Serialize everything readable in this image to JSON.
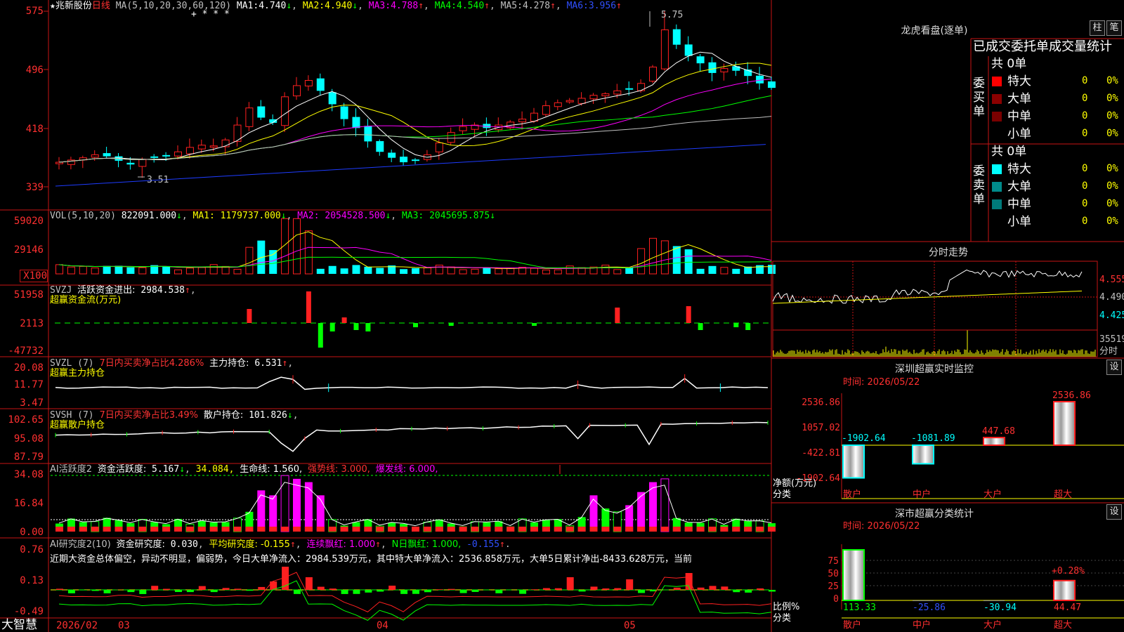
{
  "stock": {
    "name": "兆新股份",
    "period": "日线",
    "star": "★"
  },
  "colors": {
    "up": "#ff2020",
    "down": "#00ffff",
    "ma1": "#ffffff",
    "ma2": "#ffff00",
    "ma3": "#ff00ff",
    "ma4": "#00ff00",
    "ma5": "#c0c0c0",
    "ma6": "#1e3cff",
    "grid": "#c81414",
    "yellow": "#ffff00",
    "green": "#00ff00"
  },
  "main": {
    "ma_label": "MA(5,10,20,30,60,120)",
    "ma": [
      {
        "name": "MA1:",
        "value": "4.740",
        "arrow": "↓"
      },
      {
        "name": "MA2:",
        "value": "4.940",
        "arrow": "↓"
      },
      {
        "name": "MA3:",
        "value": "4.788",
        "arrow": "↑"
      },
      {
        "name": "MA4:",
        "value": "4.540",
        "arrow": "↑"
      },
      {
        "name": "MA5:",
        "value": "4.278",
        "arrow": "↑"
      },
      {
        "name": "MA6:",
        "value": "3.956",
        "arrow": "↑"
      }
    ],
    "y_ticks": [
      "575",
      "496",
      "418",
      "339"
    ],
    "high_label": "5.75",
    "low_label": "3.51",
    "marks": "+  * * *"
  },
  "vol": {
    "label": "VOL(5,10,20)",
    "value": "822091.000",
    "v_arrow": "↓",
    "ma1": "MA1: 1179737.000",
    "ma1_arrow": "↓",
    "ma2": "MA2: 2054528.500",
    "ma2_arrow": "↓",
    "ma3": "MA3: 2045695.875",
    "ma3_arrow": "↓",
    "y_ticks": [
      "59020",
      "29146"
    ],
    "unit": "X100"
  },
  "svzj": {
    "name": "SVZJ",
    "desc": "活跃资金进出:",
    "value": "2984.538",
    "arrow": "↑",
    "sub": "超赢资金流(万元)",
    "y_ticks": [
      "51958",
      "2113",
      "-47732"
    ]
  },
  "svzl": {
    "name": "SVZL (7)",
    "desc": "7日内买卖净占比4.286%",
    "main": "主力持仓:",
    "value": "6.531",
    "arrow": "↑",
    "sub": "超赢主力持仓",
    "y_ticks": [
      "20.08",
      "11.77",
      "3.47"
    ]
  },
  "svsh": {
    "name": "SVSH (7)",
    "desc": "7日内买卖净占比3.49%",
    "main": "散户持仓:",
    "value": "101.826",
    "arrow": "↓",
    "sub": "超赢散户持仓",
    "y_ticks": [
      "102.65",
      "95.08",
      "87.79"
    ]
  },
  "ai1": {
    "name": "AI活跃度2",
    "desc": "资金活跃度:",
    "value": "5.167",
    "arrow": "↓",
    "v2": "34.084,",
    "v3": "生命线: 1.560,",
    "v4": "强势线: 3.000,",
    "v5": "爆发线: 6.000,",
    "y_ticks": [
      "34.08",
      "16.84",
      "0.00"
    ]
  },
  "ai2": {
    "name": "AI研究度2(10)",
    "desc": "资金研究度:",
    "value": "0.030",
    "avg": "平均研究度: -0.155",
    "avg_arrow": "↑",
    "c1": "连续飘红: 1.000",
    "c1_arrow": "↑",
    "c2": "N日飘红: 1.000,",
    "c3": "-0.155",
    "c3_arrow": "↑",
    "text": "近期大资金总体偏空，异动不明显，偏弱势，今日大单净流入：2984.539万元，其中特大单净流入：2536.858万元，大单5日累计净出-8433.628万元，当前",
    "y_ticks": [
      "0.76",
      "0.13",
      "-0.49"
    ]
  },
  "xaxis": {
    "brand": "大智慧",
    "labels": [
      "2026/02",
      "03",
      "04",
      "05"
    ]
  },
  "lhb": {
    "title": "龙虎看盘(逐单)",
    "btn1": "柱",
    "btn2": "笔",
    "header": "已成交委托单成交量统计",
    "buy": {
      "label": "委买单",
      "total": "共 0单",
      "rows": [
        {
          "name": "特大",
          "n": "0",
          "p": "0%"
        },
        {
          "name": "大单",
          "n": "0",
          "p": "0%"
        },
        {
          "name": "中单",
          "n": "0",
          "p": "0%"
        },
        {
          "name": "小单",
          "n": "0",
          "p": "0%"
        }
      ]
    },
    "sell": {
      "label": "委卖单",
      "total": "共 0单",
      "rows": [
        {
          "name": "特大",
          "n": "0",
          "p": "0%"
        },
        {
          "name": "大单",
          "n": "0",
          "p": "0%"
        },
        {
          "name": "中单",
          "n": "0",
          "p": "0%"
        },
        {
          "name": "小单",
          "n": "0",
          "p": "0%"
        }
      ]
    }
  },
  "intraday": {
    "title": "分时走势",
    "p1": "4.555",
    "p2": "4.490",
    "p3": "4.425",
    "vol": "35519",
    "vol_label": "分时"
  },
  "monitor": {
    "title": "深圳超赢实时监控",
    "btn": "设",
    "time": "时间: 2026/05/22",
    "y_ticks": [
      "2536.86",
      "1057.02",
      "-422.81",
      "-1902.64"
    ],
    "ylabel": "净额(万元)",
    "xlabel": "分类",
    "categories": [
      "散户",
      "中户",
      "大户",
      "超大"
    ],
    "values": [
      -1902.64,
      -1081.89,
      447.68,
      2536.86
    ],
    "value_labels": [
      "-1902.64",
      "-1081.89",
      "447.68",
      "2536.86"
    ]
  },
  "classify": {
    "title": "深市超赢分类统计",
    "btn": "设",
    "time": "时间: 2026/05/22",
    "y_ticks": [
      "75",
      "50",
      "25",
      "0"
    ],
    "ylabel": "比例%",
    "xlabel": "分类",
    "categories": [
      "散户",
      "中户",
      "大户",
      "超大"
    ],
    "values": [
      113.33,
      -25.86,
      -30.94,
      44.47
    ],
    "value_labels": [
      "113.33",
      "-25.86",
      "-30.94",
      "44.47"
    ],
    "annotation": "+0.28%"
  }
}
